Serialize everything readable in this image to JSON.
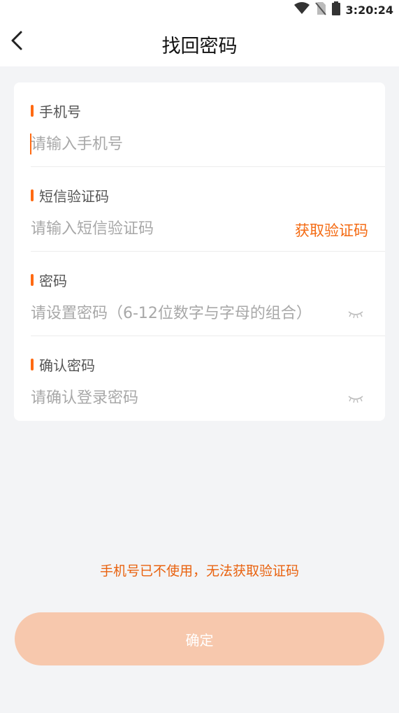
{
  "status_bar": {
    "time": "3:20:24",
    "icons": [
      "wifi-icon",
      "no-sim-icon",
      "battery-icon"
    ]
  },
  "header": {
    "title": "找回密码",
    "back_icon": "chevron-left-icon"
  },
  "form": {
    "phone": {
      "label": "手机号",
      "placeholder": "请输入手机号"
    },
    "sms_code": {
      "label": "短信验证码",
      "placeholder": "请输入短信验证码",
      "get_code_label": "获取验证码"
    },
    "password": {
      "label": "密码",
      "placeholder": "请设置密码（6-12位数字与字母的组合）",
      "visibility_icon": "eye-closed-icon"
    },
    "confirm_password": {
      "label": "确认密码",
      "placeholder": "请确认登录密码",
      "visibility_icon": "eye-closed-icon"
    }
  },
  "footer": {
    "note": "手机号已不使用，无法获取验证码",
    "confirm_label": "确定"
  },
  "colors": {
    "accent": "#ff6a12",
    "button_disabled": "#f7c8ad",
    "background": "#f3f4f6"
  }
}
